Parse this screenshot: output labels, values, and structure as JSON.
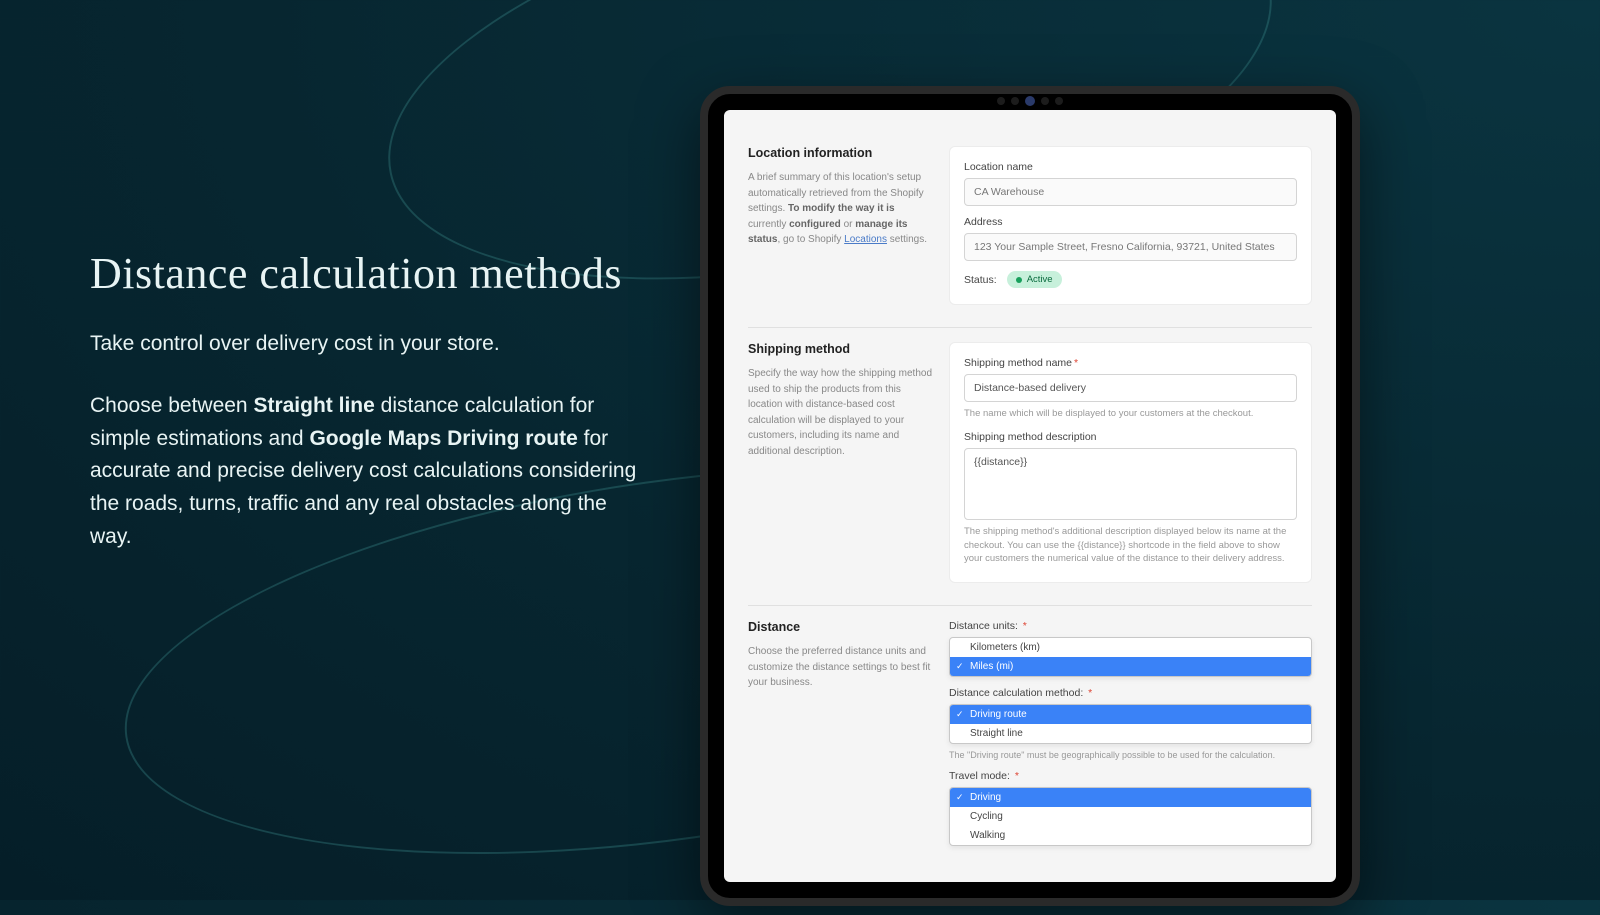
{
  "marketing": {
    "title": "Distance calculation methods",
    "lead": "Take control over delivery cost in your store.",
    "body_pre": "Choose between ",
    "body_b1": "Straight line",
    "body_mid1": " distance calculation for simple estimations and ",
    "body_b2": "Google Maps Driving route",
    "body_post": " for accurate and precise delivery cost calculations considering the roads, turns, traffic and any real obstacles along the way."
  },
  "location_info": {
    "heading": "Location information",
    "desc_pre": "A brief summary of this location's setup automatically retrieved from the Shopify settings. ",
    "desc_b1": "To modify the way it is",
    "desc_mid1": " currently ",
    "desc_b2": "configured",
    "desc_mid2": " or ",
    "desc_b3": "manage its status",
    "desc_post1": ", go to Shopify ",
    "desc_link": "Locations",
    "desc_post2": " settings.",
    "name_label": "Location name",
    "name_value": "CA Warehouse",
    "addr_label": "Address",
    "addr_value": "123 Your Sample Street, Fresno California, 93721, United States",
    "status_label": "Status:",
    "status_badge": "Active"
  },
  "shipping": {
    "heading": "Shipping method",
    "desc": "Specify the way how the shipping method used to ship the products from this location with distance-based cost calculation will be displayed to your customers, including its name and additional description.",
    "name_label": "Shipping method name",
    "name_value": "Distance-based delivery",
    "name_help": "The name which will be displayed to your customers at the checkout.",
    "desc_label": "Shipping method description",
    "desc_value": "{{distance}}",
    "desc_help": "The shipping method's additional description displayed below its name at the checkout. You can use the {{distance}} shortcode in the field above to show your customers the numerical value of the distance to their delivery address."
  },
  "distance": {
    "heading": "Distance",
    "desc": "Choose the preferred distance units and customize the distance settings to best fit your business.",
    "units_label": "Distance units:",
    "units_options": {
      "a": "Kilometers (km)",
      "b": "Miles (mi)"
    },
    "calc_label": "Distance calculation method:",
    "calc_options": {
      "a": "Driving route",
      "b": "Straight line"
    },
    "calc_note": "The \"Driving route\" must be geographically possible to be used for the calculation.",
    "travel_label": "Travel mode:",
    "travel_options": {
      "a": "Driving",
      "b": "Cycling",
      "c": "Walking"
    }
  }
}
